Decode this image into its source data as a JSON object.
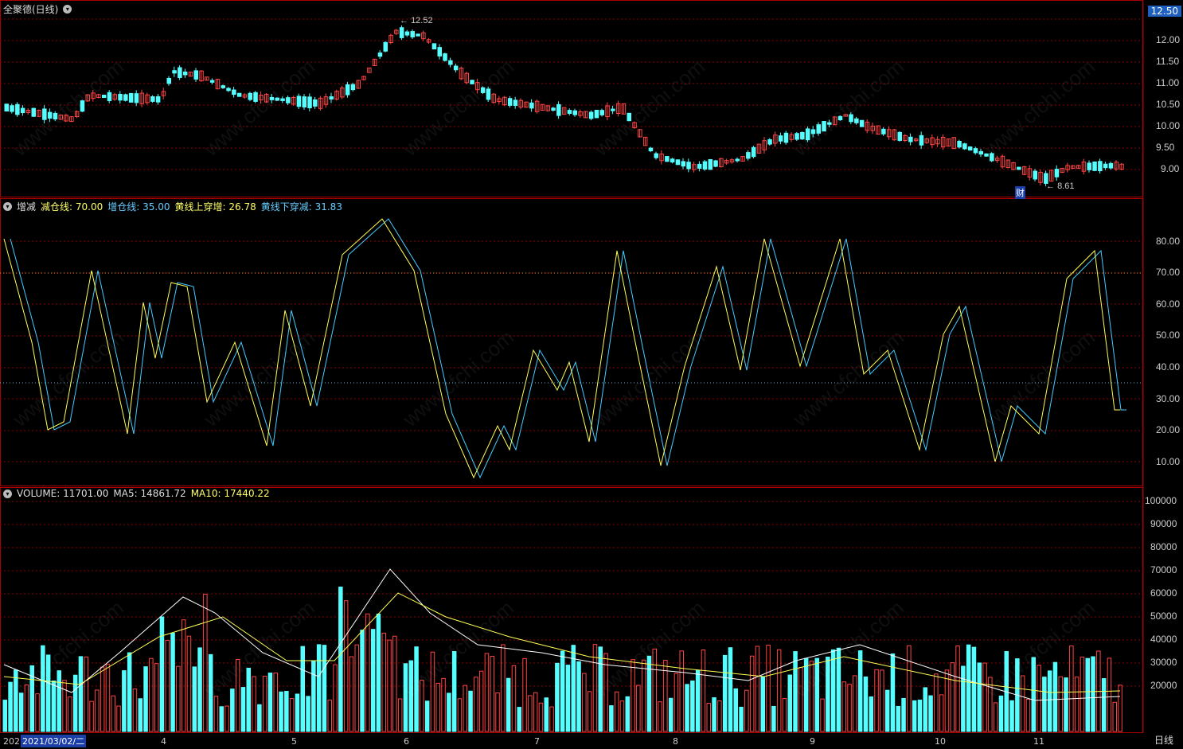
{
  "window": {
    "title": "全聚德(日线)",
    "period_label": "日线"
  },
  "price_panel": {
    "current_price": "12.50",
    "high_marker": "12.52",
    "low_marker": "8.61",
    "badge": "财",
    "axis_ticks": [
      "12.50",
      "12.00",
      "11.50",
      "11.00",
      "10.50",
      "10.00",
      "9.50",
      "9.00"
    ],
    "axis_top_partial": "12.50"
  },
  "indicator_panel": {
    "name": "增减",
    "params": [
      {
        "label": "减仓线",
        "value": "70.00",
        "color": "#ffff66"
      },
      {
        "label": "增仓线",
        "value": "35.00",
        "color": "#66ccff"
      },
      {
        "label": "黄线上穿增",
        "value": "26.78",
        "color": "#ffff66"
      },
      {
        "label": "黄线下穿减",
        "value": "31.83",
        "color": "#66ccff"
      }
    ],
    "axis_ticks": [
      "80.00",
      "70.00",
      "60.00",
      "50.00",
      "40.00",
      "30.00",
      "20.00",
      "10.00"
    ]
  },
  "volume_panel": {
    "name": "VOLUME",
    "value": "11701.00",
    "ma5_label": "MA5",
    "ma5_value": "14861.72",
    "ma10_label": "MA10",
    "ma10_value": "17440.22",
    "axis_ticks": [
      "100000",
      "90000",
      "80000",
      "70000",
      "60000",
      "50000",
      "40000",
      "30000",
      "20000"
    ]
  },
  "date_axis": {
    "first_label": "202",
    "selected_date": "2021/03/02/二",
    "months": [
      "4",
      "5",
      "6",
      "7",
      "8",
      "9",
      "10",
      "11"
    ]
  },
  "colors": {
    "up": "#ff4444",
    "down": "#55ffff",
    "yellow": "#ffff55",
    "cyan_line": "#44ccff",
    "grid": "#8b0000"
  },
  "watermark": "www.cfchi.com"
}
